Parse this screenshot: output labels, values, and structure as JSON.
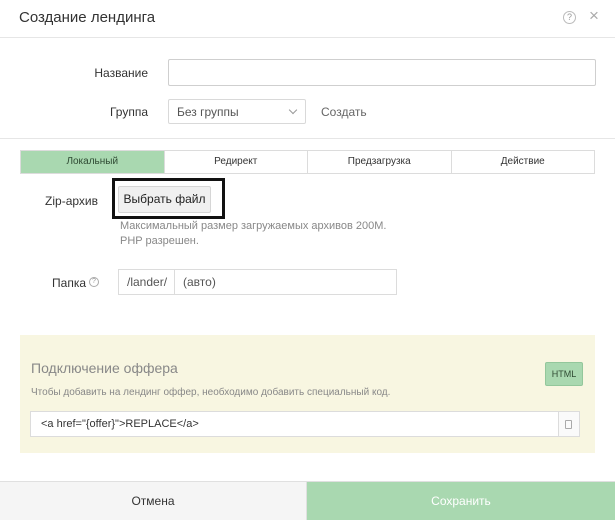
{
  "dialog": {
    "title": "Создание лендинга",
    "help_symbol": "?",
    "close_symbol": "×"
  },
  "form": {
    "name_label": "Название",
    "name_value": "",
    "group_label": "Группа",
    "group_value": "Без группы",
    "create_link": "Создать"
  },
  "tabs": [
    {
      "label": "Локальный",
      "active": true
    },
    {
      "label": "Редирект",
      "active": false
    },
    {
      "label": "Предзагрузка",
      "active": false
    },
    {
      "label": "Действие",
      "active": false
    }
  ],
  "local": {
    "zip_label": "Zip-архив",
    "file_button": "Выбрать файл",
    "hint_line1": "Максимальный размер загружаемых архивов 200М.",
    "hint_line2": "PHP разрешен.",
    "folder_label": "Папка",
    "folder_help_symbol": "?",
    "folder_prefix": "/lander/",
    "folder_value": "(авто)"
  },
  "offer": {
    "title": "Подключение оффера",
    "description": "Чтобы добавить на лендинг оффер, необходимо добавить специальный код.",
    "badge": "HTML",
    "code": "<a href=\"{offer}\">REPLACE</a>"
  },
  "footer": {
    "cancel_label": "Отмена",
    "save_label": "Сохранить"
  },
  "colors": {
    "accent": "#a9d8b0",
    "panel_bg": "#f8f6e1"
  }
}
